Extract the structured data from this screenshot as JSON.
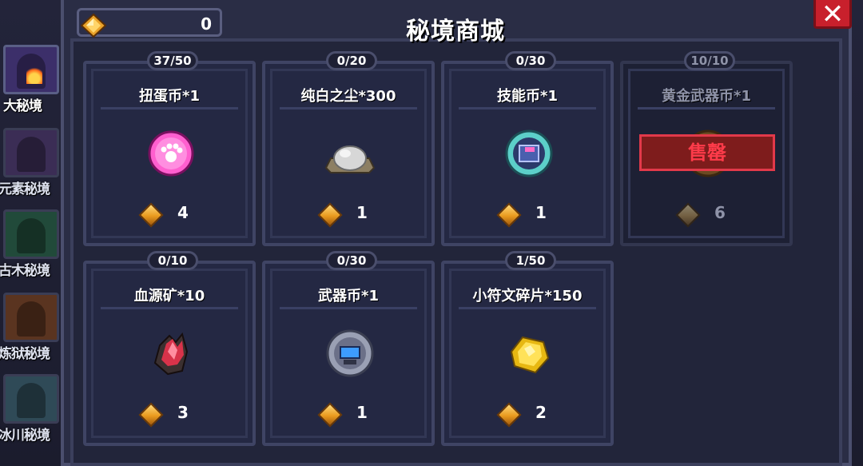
{
  "header": {
    "title": "秘境商城",
    "currency_amount": "0",
    "close_label": "✕"
  },
  "side_tabs": [
    {
      "label": "大秘境",
      "active": true
    },
    {
      "label": "元素秘境"
    },
    {
      "label": "古木秘境"
    },
    {
      "label": "炼狱秘境"
    },
    {
      "label": "冰川秘境"
    }
  ],
  "shop": {
    "items": [
      {
        "name": "扭蛋币*1",
        "stock": "37/50",
        "price": "4",
        "icon": "gacha-coin-icon"
      },
      {
        "name": "纯白之尘*300",
        "stock": "0/20",
        "price": "1",
        "icon": "white-dust-icon"
      },
      {
        "name": "技能币*1",
        "stock": "0/30",
        "price": "1",
        "icon": "skill-coin-icon"
      },
      {
        "name": "黄金武器币*1",
        "stock": "10/10",
        "price": "6",
        "icon": "gold-weapon-coin-icon",
        "sold_out": true,
        "sold_label": "售罄"
      },
      {
        "name": "血源矿*10",
        "stock": "0/10",
        "price": "3",
        "icon": "blood-ore-icon"
      },
      {
        "name": "武器币*1",
        "stock": "0/30",
        "price": "1",
        "icon": "weapon-coin-icon"
      },
      {
        "name": "小符文碎片*150",
        "stock": "1/50",
        "price": "2",
        "icon": "rune-shard-icon"
      }
    ]
  },
  "colors": {
    "accent": "#e99a1e",
    "close": "#c8202c",
    "sold": "#ff3b4a"
  }
}
